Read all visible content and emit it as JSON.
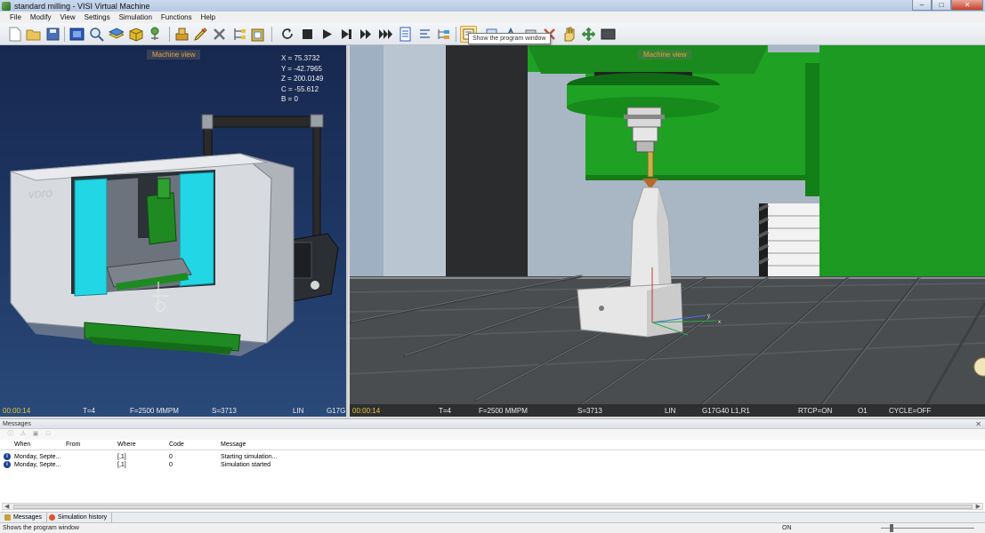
{
  "window": {
    "title": "standard milling - VISI Virtual Machine"
  },
  "menu": [
    "File",
    "Modify",
    "View",
    "Settings",
    "Simulation",
    "Functions",
    "Help"
  ],
  "toolbar": {
    "tooltip": "Show the program window"
  },
  "left_view": {
    "title": "Machine view",
    "coords": [
      "X = 75.3732",
      "Y = -42.7965",
      "Z = 200.0149",
      "C = -55.612",
      "B = 0"
    ],
    "brand": "voro",
    "status": {
      "time": "00:00:14",
      "tool": "T=4",
      "feed": "F=2500 MMPM",
      "speed": "S=3713",
      "mode": "LIN",
      "gcode": "G17G"
    }
  },
  "right_view": {
    "title": "Machine view",
    "axis_labels": {
      "y": "y",
      "x": "x"
    },
    "status": {
      "time": "00:00:14",
      "tool": "T=4",
      "feed": "F=2500 MMPM",
      "speed": "S=3713",
      "mode": "LIN",
      "gcode": "G17G40 L1,R1",
      "rtcp": "RTCP=ON",
      "program": "O1",
      "cycle": "CYCLE=OFF"
    }
  },
  "messages": {
    "panel_title": "Messages",
    "columns": {
      "when": "When",
      "from": "From",
      "where": "Where",
      "code": "Code",
      "message": "Message"
    },
    "rows": [
      {
        "when": "Monday, Septe...",
        "from": "",
        "where": "[,1]",
        "code": "0",
        "message": "Starting simulation..."
      },
      {
        "when": "Monday, Septe...",
        "from": "",
        "where": "[,1]",
        "code": "0",
        "message": "Simulation started"
      }
    ]
  },
  "tabs": [
    "Messages",
    "Simulation history"
  ],
  "statusbar": {
    "text": "Shows the program window",
    "mode": "ON"
  },
  "colors": {
    "machine_green": "#1f8a22",
    "door_cyan": "#22d6e6",
    "overlay_title": "#e7a33a",
    "time_yellow": "#e3c53a"
  }
}
